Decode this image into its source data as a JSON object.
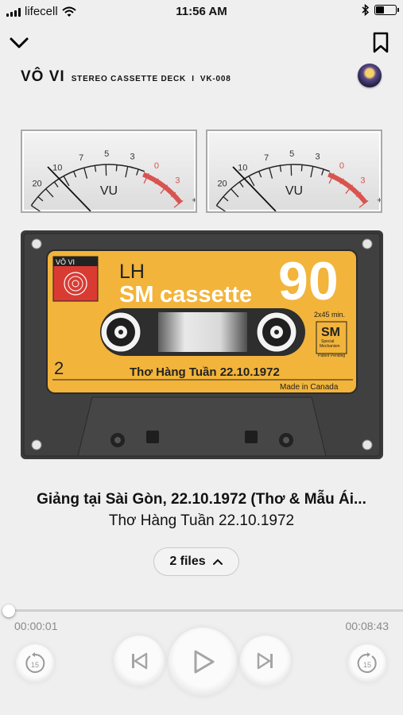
{
  "status_bar": {
    "carrier": "lifecell",
    "time": "11:56 AM"
  },
  "header": {
    "brand": "VÔ VI",
    "subtitle": "STEREO CASSETTE DECK  I  VK-008"
  },
  "vu_meter": {
    "scale_labels": [
      "-",
      "20",
      "10",
      "7",
      "5",
      "3",
      "0",
      "3",
      "+"
    ],
    "label": "VU"
  },
  "cassette": {
    "sticker_label": "VÔ VI",
    "brand_small": "LH",
    "brand_sm": "SM",
    "brand_word": "cassette",
    "length": "90",
    "duration": "2x45 min.",
    "badge_top": "SM",
    "badge_line1": "Special",
    "badge_line2": "Mechanism",
    "badge_line3": "Patent Pending",
    "side": "2",
    "label_title": "Thơ Hàng Tuần 22.10.1972",
    "made_in": "Made in Canada"
  },
  "track": {
    "title": "Giảng tại Sài Gòn, 22.10.1972 (Thơ & Mẫu Ái...",
    "album": "Thơ Hàng Tuần 22.10.1972"
  },
  "files_button": {
    "label": "2 files"
  },
  "playback": {
    "current_time": "00:00:01",
    "total_time": "00:08:43",
    "progress": 0.002,
    "skip_seconds": "15"
  },
  "icons": {
    "signal": "signal-bars-icon",
    "wifi": "wifi-icon",
    "bluetooth": "bluetooth-icon",
    "battery": "battery-icon",
    "collapse": "chevron-down-icon",
    "bookmark": "bookmark-icon",
    "files_toggle": "chevron-up-icon",
    "rewind": "rewind-15-icon",
    "forward": "forward-15-icon",
    "prev": "skip-previous-icon",
    "play": "play-icon",
    "next": "skip-next-icon"
  },
  "colors": {
    "accent_red": "#d9534f",
    "cassette_yellow": "#f2b43a",
    "cassette_body": "#3c3c3c"
  }
}
